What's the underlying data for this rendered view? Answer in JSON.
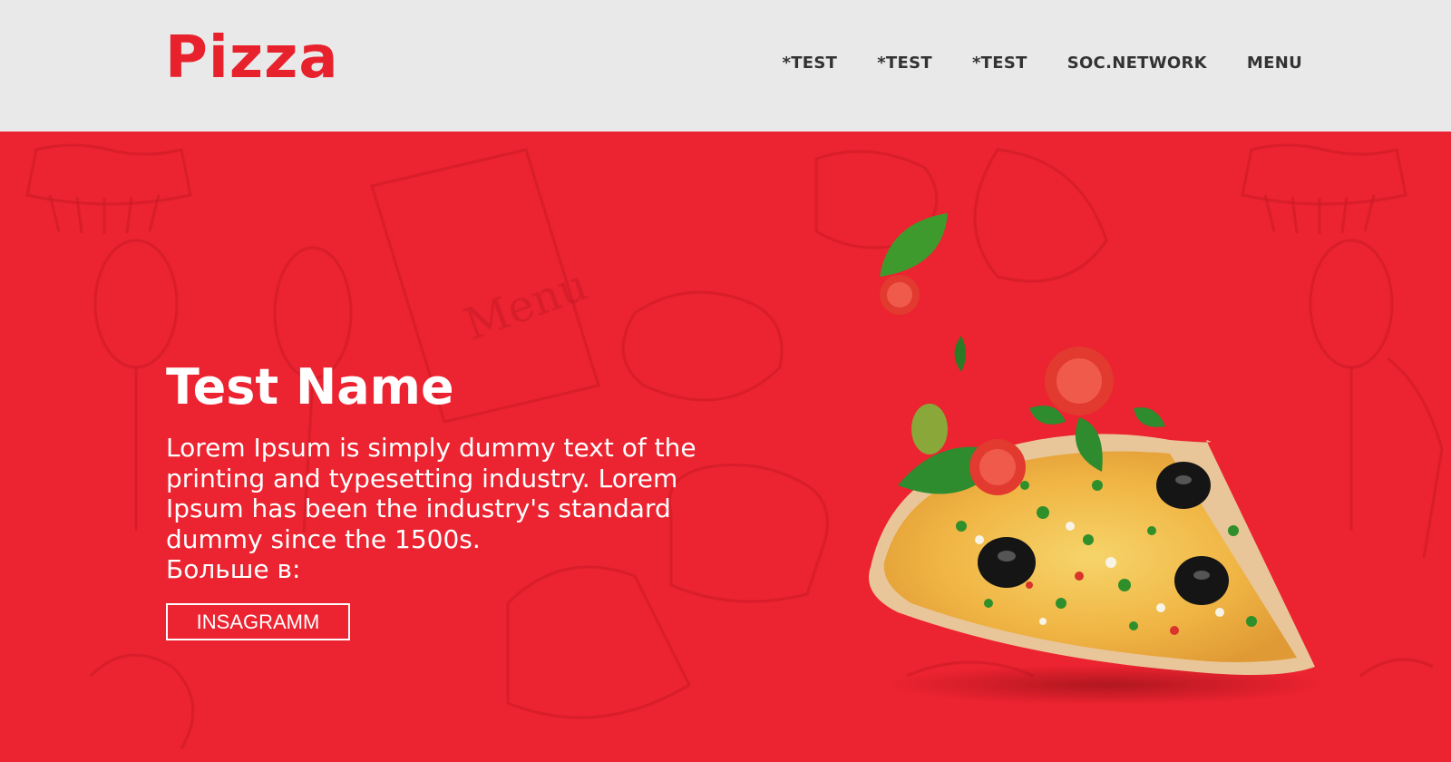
{
  "header": {
    "logo_text": "Pizza",
    "nav": [
      "*TEST",
      "*TEST",
      "*TEST",
      "SOC.NETWORK",
      "MENU"
    ]
  },
  "hero": {
    "title": "Test Name",
    "description": "Lorem Ipsum is simply dummy text of the printing and typesetting industry. Lorem Ipsum has been the industry's standard dummy since the 1500s.",
    "more_label": "Больше в:",
    "button_label": "INSAGRAMM"
  },
  "colors": {
    "brand_red": "#ec2330",
    "header_bg": "#e9e9e9",
    "nav_text": "#333333"
  },
  "icons": {
    "hero_image": "pizza-slice-with-falling-toppings"
  }
}
